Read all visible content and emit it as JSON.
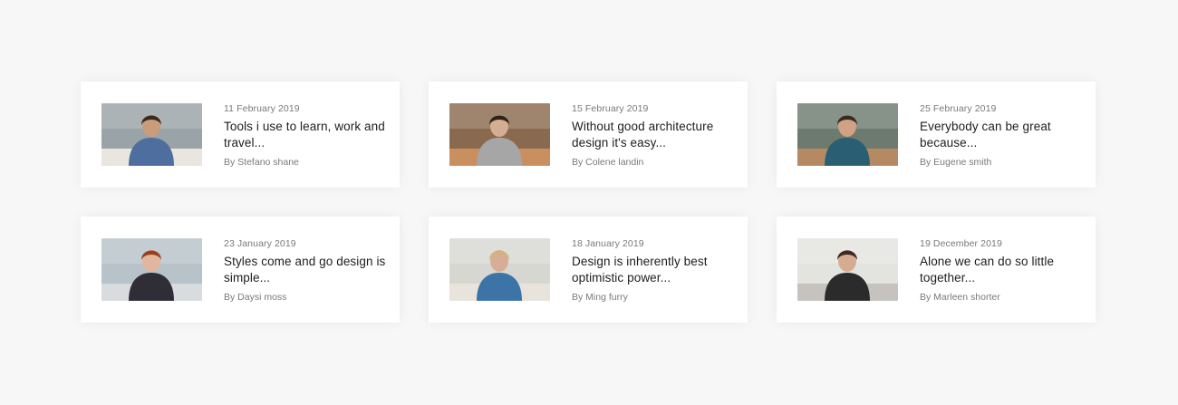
{
  "posts": [
    {
      "date": "11 February 2019",
      "title": "Tools i use to learn, work and travel...",
      "author": "By Stefano shane",
      "image": "man-with-glasses-reviewing-papers",
      "colors": {
        "bg": "#9aa3a7",
        "shirt": "#4f6ea0",
        "skin": "#c99d7c",
        "hair": "#3b2a1e",
        "desk": "#e9e6e0"
      }
    },
    {
      "date": "15 February 2019",
      "title": "Without good architecture design it's easy...",
      "author": "By Colene landin",
      "image": "woman-in-cafe-with-phone",
      "colors": {
        "bg": "#8a6a4f",
        "shirt": "#a7a6a6",
        "skin": "#d4ad92",
        "hair": "#2d211a",
        "desk": "#c98f5f"
      }
    },
    {
      "date": "25 February 2019",
      "title": "Everybody can be great because...",
      "author": "By Eugene smith",
      "image": "two-men-having-coffee",
      "colors": {
        "bg": "#6d7b6e",
        "shirt": "#2a5f73",
        "skin": "#d0a183",
        "hair": "#3a2b21",
        "desk": "#b58a62"
      }
    },
    {
      "date": "23 January 2019",
      "title": "Styles come and go design is simple...",
      "author": "By Daysi moss",
      "image": "two-women-at-laptop",
      "colors": {
        "bg": "#b7c3c9",
        "shirt": "#2f2d35",
        "skin": "#e0b79e",
        "hair": "#9c3d1f",
        "desk": "#d9dcde"
      }
    },
    {
      "date": "18 January 2019",
      "title": "Design is inherently best optimistic power...",
      "author": "By Ming furry",
      "image": "doctor-with-patient",
      "colors": {
        "bg": "#d7d7d2",
        "shirt": "#3c74a8",
        "skin": "#d7ae95",
        "hair": "#d1b47d",
        "desk": "#e8e4dc"
      }
    },
    {
      "date": "19 December 2019",
      "title": "Alone we can do so little together...",
      "author": "By Marleen shorter",
      "image": "woman-drinking-coffee",
      "colors": {
        "bg": "#e3e3e0",
        "shirt": "#2b2b2b",
        "skin": "#d6ac91",
        "hair": "#3b2a1f",
        "desk": "#c6c3bf"
      }
    }
  ]
}
